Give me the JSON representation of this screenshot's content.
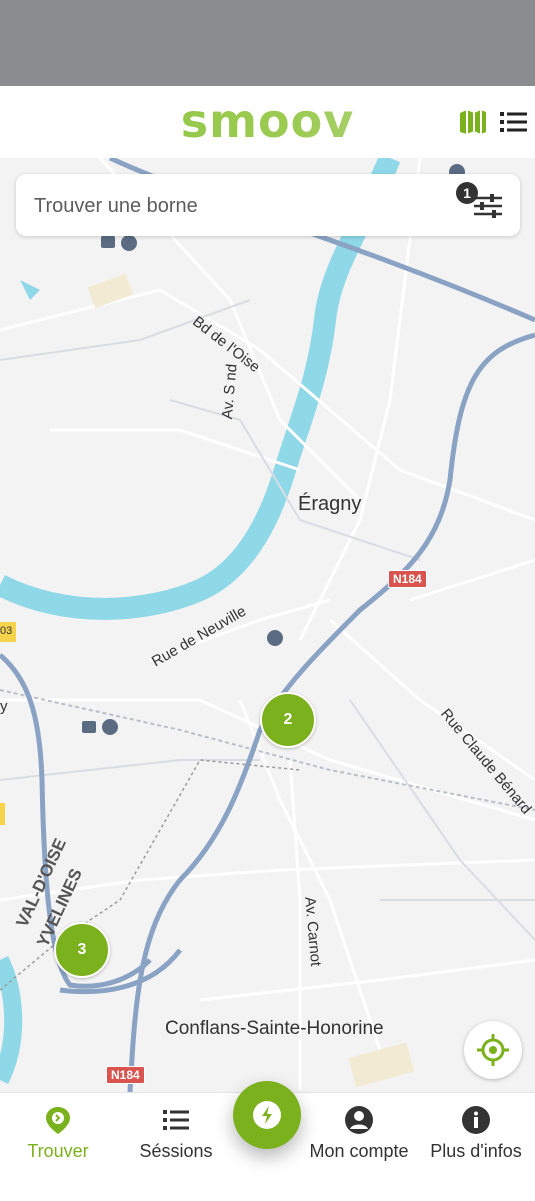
{
  "header": {
    "logo_text": "smoov",
    "map_icon": "map-icon",
    "list_icon": "list-icon",
    "accent_color": "#7cb11e"
  },
  "search": {
    "placeholder": "Trouver une borne",
    "filter_count": "1",
    "filter_icon": "sliders-icon"
  },
  "map": {
    "labels": {
      "eragny": "Éragny",
      "conflans": "Conflans-Sainte-Honorine",
      "bd_oise": "Bd de l'Oise",
      "av_sus": "Av. S nd",
      "rue_neuville": "Rue de Neuville",
      "rue_claude": "Rue Claude Bénard",
      "av_carnot": "Av. Carnot",
      "val_oise": "VAL-D'OISE",
      "yvelines": "YVELINES",
      "left_y": "y",
      "left_03": "03"
    },
    "road_shields": [
      "N184",
      "N184"
    ],
    "clusters": [
      {
        "count": "2"
      },
      {
        "count": "3"
      }
    ],
    "locate_icon": "locate-icon"
  },
  "bottom_nav": {
    "items": [
      {
        "label": "Trouver",
        "icon": "find-icon",
        "active": true
      },
      {
        "label": "Séssions",
        "icon": "list-icon",
        "active": false
      },
      {
        "label": "Mon compte",
        "icon": "account-icon",
        "active": false
      },
      {
        "label": "Plus d'infos",
        "icon": "info-icon",
        "active": false
      }
    ],
    "center_icon": "bolt-icon"
  }
}
